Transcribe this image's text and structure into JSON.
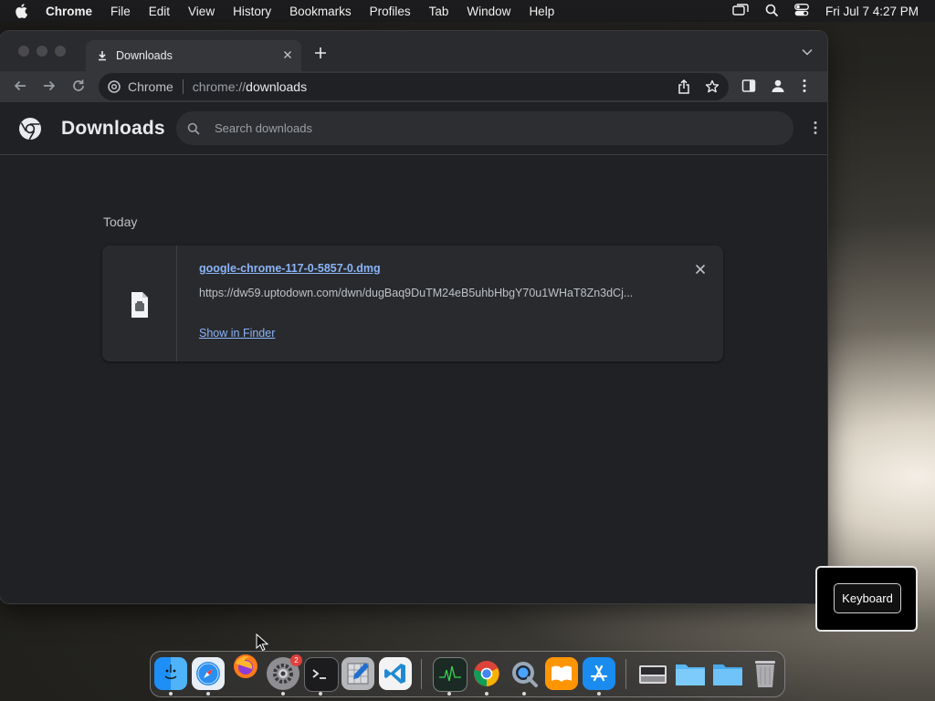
{
  "menubar": {
    "app_name": "Chrome",
    "items": [
      "File",
      "Edit",
      "View",
      "History",
      "Bookmarks",
      "Profiles",
      "Tab",
      "Window",
      "Help"
    ],
    "clock": "Fri Jul 7  4:27 PM",
    "icons": [
      "screen-mirroring-icon",
      "spotlight-icon",
      "control-center-icon"
    ]
  },
  "browser": {
    "tab": {
      "title": "Downloads",
      "icon": "download-icon"
    },
    "omnibox": {
      "chip": "Chrome",
      "url_scheme": "chrome://",
      "url_path": "downloads"
    }
  },
  "downloads": {
    "title": "Downloads",
    "search_placeholder": "Search downloads",
    "section_date": "Today",
    "items": [
      {
        "file_name": "google-chrome-117-0-5857-0.dmg",
        "url": "https://dw59.uptodown.com/dwn/dugBaq9DuTM24eB5uhbHbgY70u1WHaT8Zn3dCj...",
        "action_label": "Show in Finder"
      }
    ]
  },
  "keyboard_widget": {
    "label": "Keyboard"
  },
  "dock": {
    "apps": [
      "Finder",
      "Safari",
      "Firefox",
      "System Settings",
      "Terminal",
      "Script Editor",
      "Visual Studio Code",
      "Activity Monitor",
      "Google Chrome",
      "QuickTime Player",
      "Books",
      "App Store"
    ],
    "system_settings_badge": "2",
    "stacks": [
      "Screenshots",
      "Documents",
      "Downloads",
      "Trash"
    ]
  }
}
